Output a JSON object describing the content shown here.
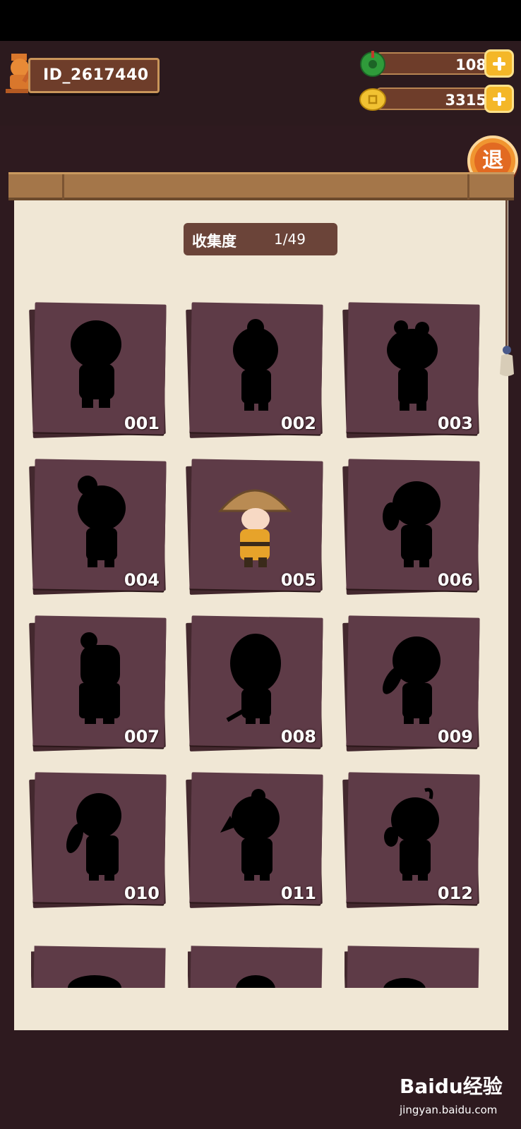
{
  "player": {
    "id": "ID_2617440"
  },
  "resources": [
    {
      "name": "jade",
      "icon": "jade-icon",
      "value": "108"
    },
    {
      "name": "coins",
      "icon": "coin-icon",
      "value": "3315"
    }
  ],
  "exit_label": "退",
  "collection": {
    "label": "收集度",
    "progress": "1/49"
  },
  "cards": [
    {
      "num": "001",
      "unlocked": false
    },
    {
      "num": "002",
      "unlocked": false
    },
    {
      "num": "003",
      "unlocked": false
    },
    {
      "num": "004",
      "unlocked": false
    },
    {
      "num": "005",
      "unlocked": true
    },
    {
      "num": "006",
      "unlocked": false
    },
    {
      "num": "007",
      "unlocked": false
    },
    {
      "num": "008",
      "unlocked": false
    },
    {
      "num": "009",
      "unlocked": false
    },
    {
      "num": "010",
      "unlocked": false
    },
    {
      "num": "011",
      "unlocked": false
    },
    {
      "num": "012",
      "unlocked": false
    }
  ],
  "watermark": {
    "logo": "Baidu经验",
    "url": "jingyan.baidu.com"
  },
  "colors": {
    "card": "#5e3b47",
    "paper": "#f0e7d5",
    "accent": "#f4b728",
    "wood": "#a47649"
  }
}
